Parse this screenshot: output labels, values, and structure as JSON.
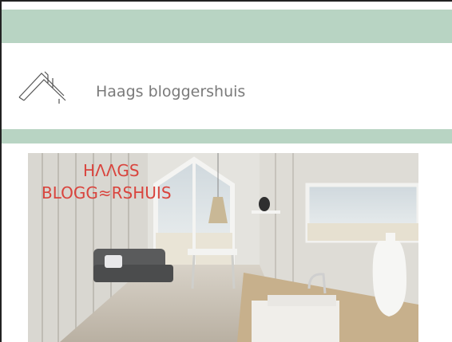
{
  "site": {
    "title": "Haags bloggershuis"
  },
  "hero": {
    "brand_line1": "HΛΛGS",
    "brand_line2": "BLOGG≈RSHUIS"
  },
  "colors": {
    "band": "#b8d4c3",
    "brand": "#d9443d",
    "title_text": "#7a7a7a"
  }
}
